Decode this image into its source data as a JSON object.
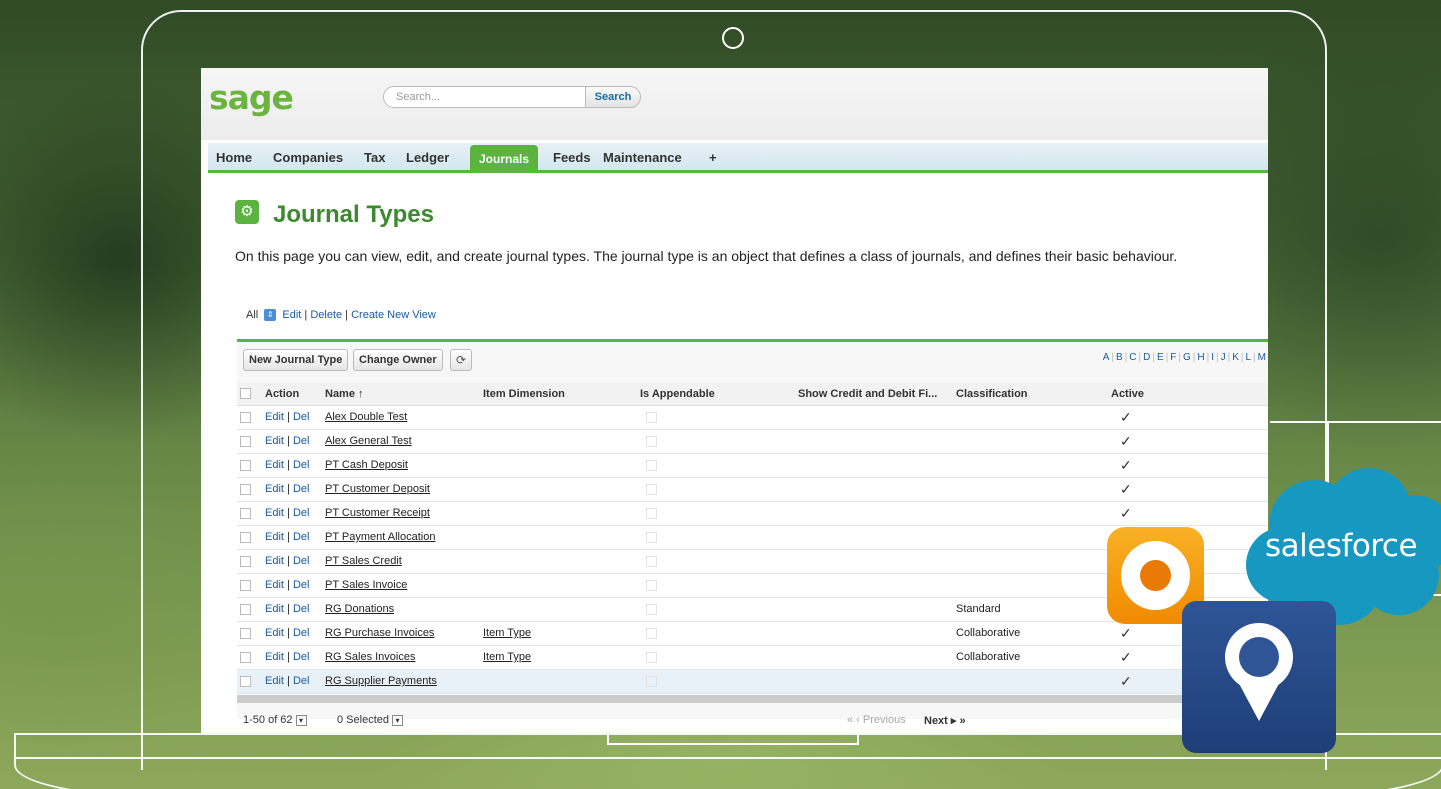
{
  "header": {
    "logo": "sage",
    "search_placeholder": "Search...",
    "search_button": "Search"
  },
  "nav": {
    "items": [
      "Home",
      "Companies",
      "Tax",
      "Ledger",
      "Journals",
      "Feeds",
      "Maintenance",
      "+"
    ],
    "active": "Journals"
  },
  "page": {
    "title": "Journal Types",
    "description": "On this page you can view, edit, and create journal types. The journal type is an object that defines a class of journals, and defines their basic behaviour."
  },
  "view": {
    "selected": "All",
    "edit": "Edit",
    "delete": "Delete",
    "create": "Create New View"
  },
  "toolbar": {
    "new_button": "New Journal Type",
    "owner_button": "Change Owner"
  },
  "alphabet": [
    "A",
    "B",
    "C",
    "D",
    "E",
    "F",
    "G",
    "H",
    "I",
    "J",
    "K",
    "L",
    "M"
  ],
  "table": {
    "columns": [
      "Action",
      "Name ↑",
      "Item Dimension",
      "Is Appendable",
      "Show Credit and Debit Fi...",
      "Classification",
      "Active"
    ],
    "rows": [
      {
        "edit": "Edit",
        "del": "Del",
        "name": "Alex Double Test",
        "item_dimension": "",
        "classification": "",
        "active": "✓"
      },
      {
        "edit": "Edit",
        "del": "Del",
        "name": "Alex General Test",
        "item_dimension": "",
        "classification": "",
        "active": "✓"
      },
      {
        "edit": "Edit",
        "del": "Del",
        "name": "PT Cash Deposit",
        "item_dimension": "",
        "classification": "",
        "active": "✓"
      },
      {
        "edit": "Edit",
        "del": "Del",
        "name": "PT Customer Deposit",
        "item_dimension": "",
        "classification": "",
        "active": "✓"
      },
      {
        "edit": "Edit",
        "del": "Del",
        "name": "PT Customer Receipt",
        "item_dimension": "",
        "classification": "",
        "active": "✓"
      },
      {
        "edit": "Edit",
        "del": "Del",
        "name": "PT Payment Allocation",
        "item_dimension": "",
        "classification": "",
        "active": ""
      },
      {
        "edit": "Edit",
        "del": "Del",
        "name": "PT Sales Credit",
        "item_dimension": "",
        "classification": "",
        "active": ""
      },
      {
        "edit": "Edit",
        "del": "Del",
        "name": "PT Sales Invoice",
        "item_dimension": "",
        "classification": "",
        "active": ""
      },
      {
        "edit": "Edit",
        "del": "Del",
        "name": "RG Donations",
        "item_dimension": "",
        "classification": "Standard",
        "active": ""
      },
      {
        "edit": "Edit",
        "del": "Del",
        "name": "RG Purchase Invoices",
        "item_dimension": "Item Type",
        "classification": "Collaborative",
        "active": "✓"
      },
      {
        "edit": "Edit",
        "del": "Del",
        "name": "RG Sales Invoices",
        "item_dimension": "Item Type",
        "classification": "Collaborative",
        "active": "✓"
      },
      {
        "edit": "Edit",
        "del": "Del",
        "name": "RG Supplier Payments",
        "item_dimension": "",
        "classification": "",
        "active": "✓"
      }
    ]
  },
  "footer": {
    "range": "1-50 of 62",
    "selected": "0 Selected",
    "previous": "« ‹ Previous",
    "next": "Next ▸ »"
  },
  "overlay": {
    "brand": "salesforce",
    "brand_color": "#1798c1",
    "accent_green": "#5cb33f"
  }
}
